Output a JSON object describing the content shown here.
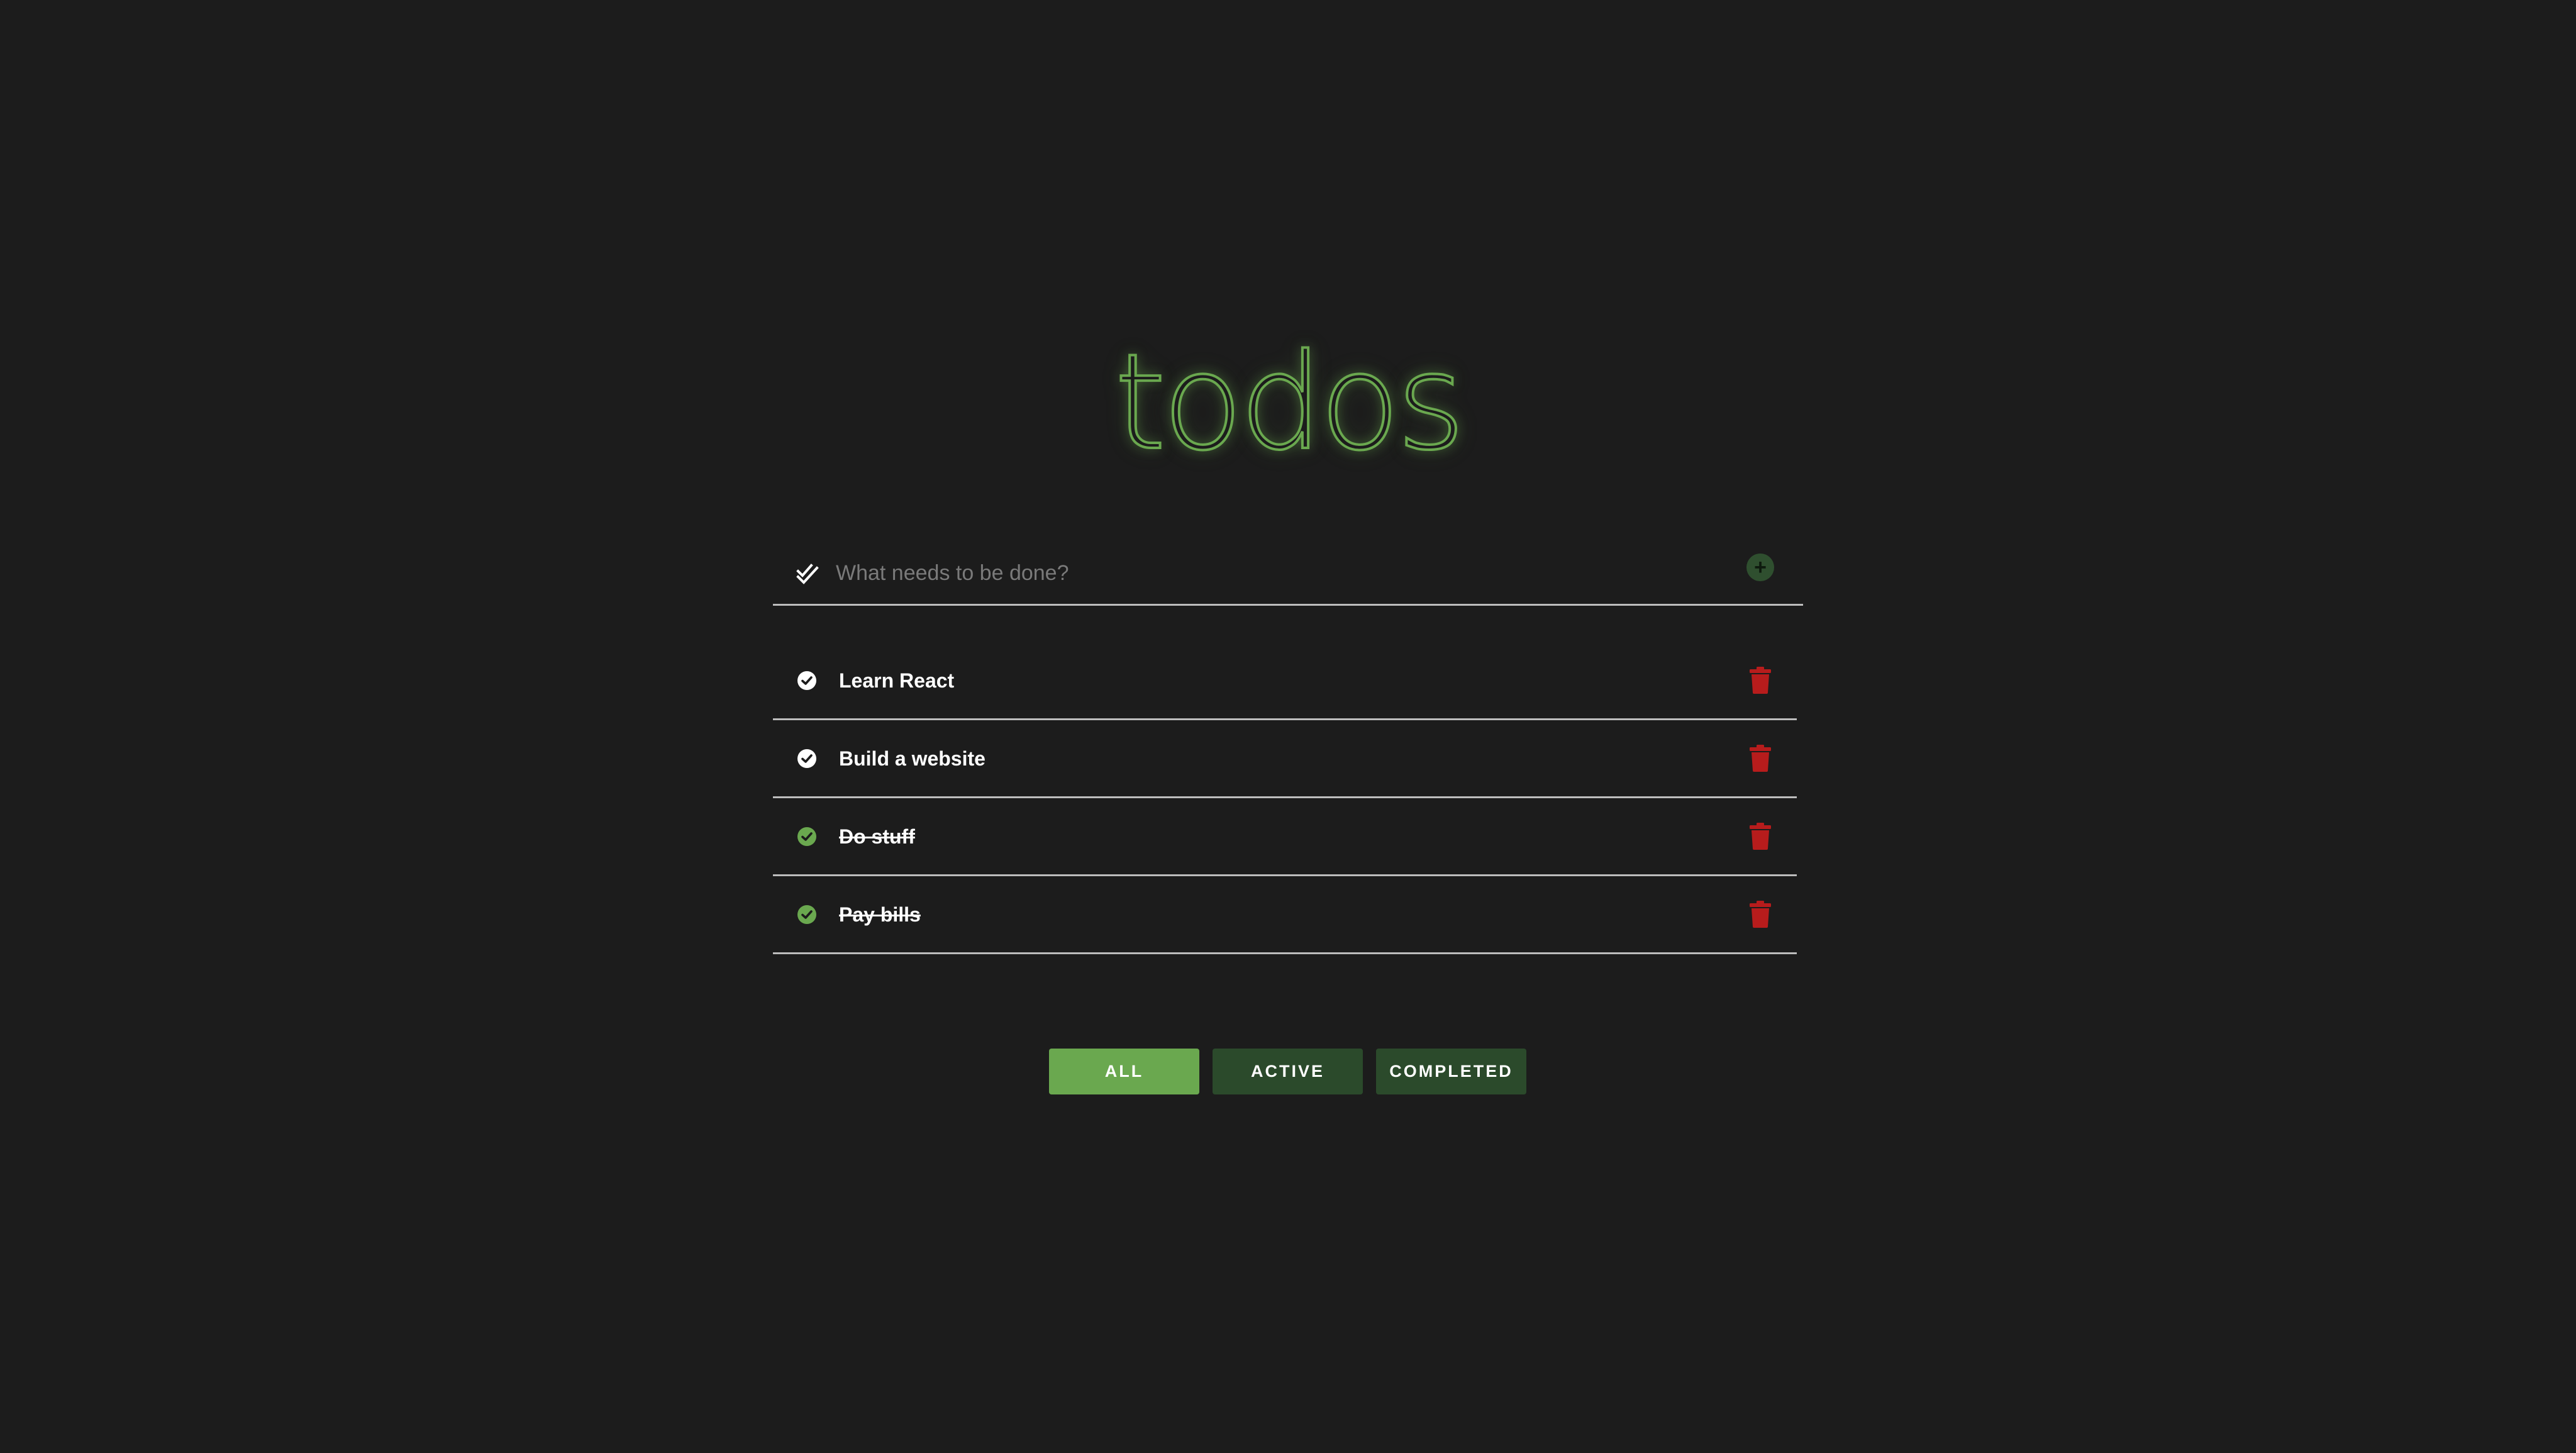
{
  "app": {
    "title": "todos"
  },
  "input": {
    "placeholder": "What needs to be done?",
    "value": ""
  },
  "todos": [
    {
      "text": "Learn React",
      "completed": false
    },
    {
      "text": "Build a website",
      "completed": false
    },
    {
      "text": "Do stuff",
      "completed": true
    },
    {
      "text": "Pay bills",
      "completed": true
    }
  ],
  "filters": [
    {
      "label": "ALL",
      "selected": true
    },
    {
      "label": "ACTIVE",
      "selected": false
    },
    {
      "label": "COMPLETED",
      "selected": false
    }
  ],
  "icons": {
    "toggle_all": "double-check-icon",
    "add": "plus-circle-icon",
    "item_check": "check-circle-icon",
    "delete": "trash-icon"
  },
  "colors": {
    "background": "#1c1c1c",
    "accent": "#6aa84f",
    "accent_dark": "#2b4a2b",
    "delete": "#b71c1c",
    "divider": "#bdbdbd",
    "text": "#ffffff"
  }
}
